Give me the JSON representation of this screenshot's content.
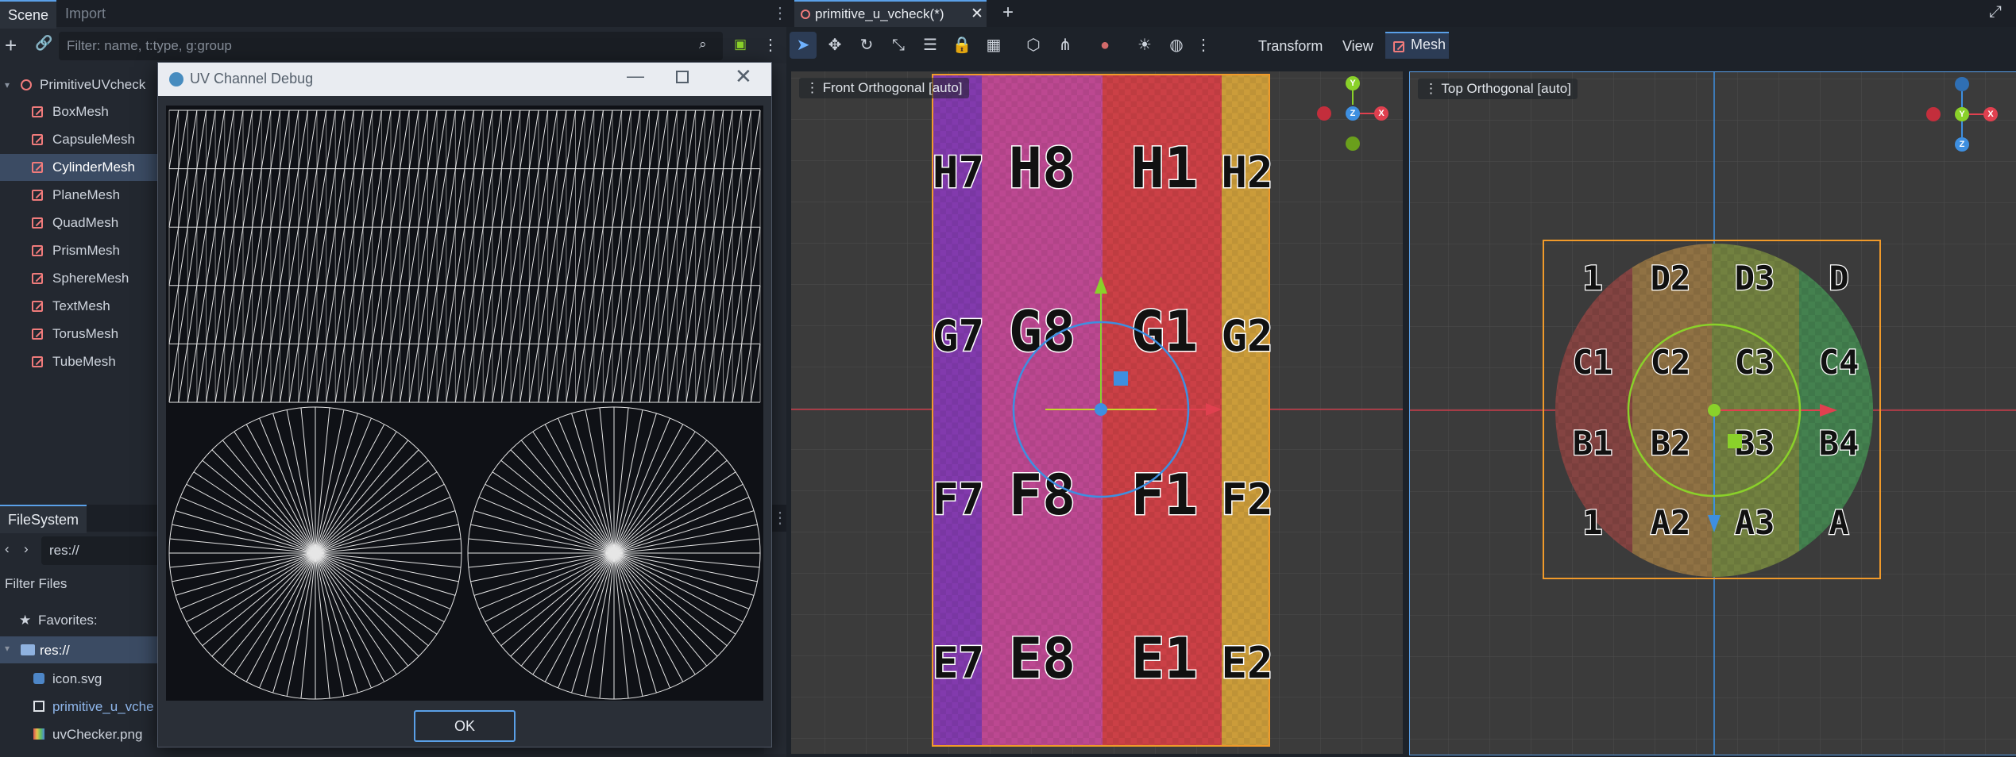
{
  "scene_dock": {
    "tabs": [
      "Scene",
      "Import"
    ],
    "filter_placeholder": "Filter: name, t:type, g:group",
    "root": "PrimitiveUVcheck",
    "nodes": [
      "BoxMesh",
      "CapsuleMesh",
      "CylinderMesh",
      "PlaneMesh",
      "QuadMesh",
      "PrismMesh",
      "SphereMesh",
      "TextMesh",
      "TorusMesh",
      "TubeMesh"
    ],
    "selected": "CylinderMesh"
  },
  "filesystem_dock": {
    "tab": "FileSystem",
    "path": "res://",
    "filter_label": "Filter Files",
    "favorites_label": "Favorites:",
    "root": "res://",
    "files": [
      "icon.svg",
      "primitive_u_vche",
      "uvChecker.png"
    ]
  },
  "dialog": {
    "title": "UV Channel Debug",
    "ok_label": "OK"
  },
  "editor": {
    "scene_tab": "primitive_u_vcheck(*)",
    "menus": {
      "transform": "Transform",
      "view": "View",
      "mesh": "Mesh"
    },
    "viewports": [
      {
        "label": "Front Orthogonal [auto]"
      },
      {
        "label": "Top Orthogonal [auto]"
      }
    ],
    "gizmo_axes": {
      "x": "X",
      "y": "Y",
      "z": "Z"
    },
    "front_checker_labels": [
      [
        "H7",
        "H8",
        "H1",
        "H2"
      ],
      [
        "G7",
        "G8",
        "G1",
        "G2"
      ],
      [
        "F7",
        "F8",
        "F1",
        "F2"
      ],
      [
        "E7",
        "E8",
        "E1",
        "E2"
      ]
    ],
    "top_checker_labels": [
      [
        "1",
        "D2",
        "D3",
        "D"
      ],
      [
        "C1",
        "C2",
        "C3",
        "C4"
      ],
      [
        "B1",
        "B2",
        "B3",
        "B4"
      ],
      [
        "1",
        "A2",
        "A3",
        "A"
      ]
    ]
  },
  "colors": {
    "accent": "#5aa0e8",
    "selection": "#3b4b63",
    "mesh_icon": "#f07b7b",
    "axis_x": "#e0404f",
    "axis_y": "#8ad12a",
    "axis_z": "#3e8fe0",
    "selection_box": "#f09a2a"
  }
}
